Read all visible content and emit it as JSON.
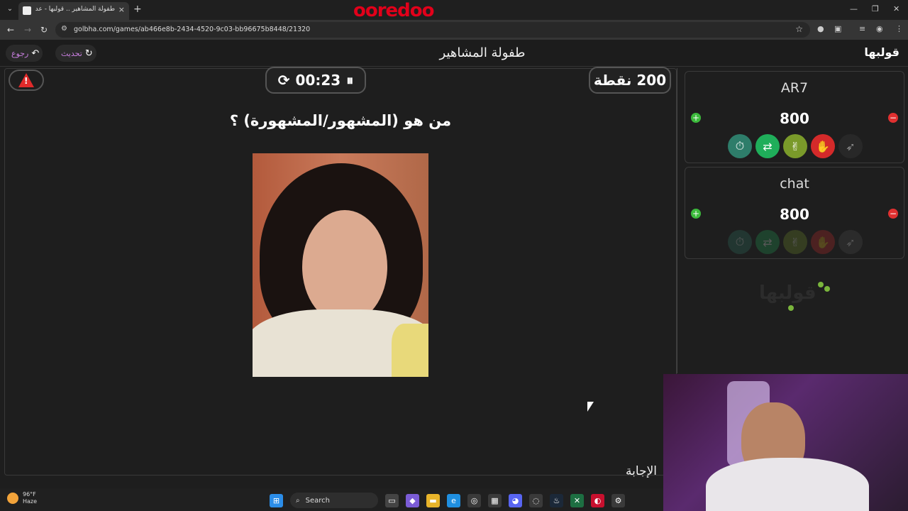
{
  "browser": {
    "tab_title": "طفولة المشاهير .. قولبها - عدل",
    "tab_close": "×",
    "new_tab": "+",
    "brand": "ooredoo",
    "url": "golbha.com/games/ab466e8b-2434-4520-9c03-bb96675b8448/21320",
    "controls": {
      "minimize": "—",
      "restore": "❐",
      "close": "✕"
    }
  },
  "header": {
    "back_label": "رجوع",
    "refresh_label": "تحديث",
    "title": "طفولة المشاهير",
    "logo": "قولبها"
  },
  "game": {
    "timer": "00:23",
    "points": "200 نقطة",
    "question": "من هو (المشهور/المشهورة) ؟",
    "answer_label": "الإجابة"
  },
  "players": [
    {
      "name": "AR7",
      "score": "800",
      "plus": "+",
      "minus": "−",
      "powerups_active": true
    },
    {
      "name": "chat",
      "score": "800",
      "plus": "+",
      "minus": "−",
      "powerups_active": false
    }
  ],
  "powerups": [
    {
      "icon": "stopwatch-icon",
      "glyph": "⏱",
      "color": "#2e7d6a"
    },
    {
      "icon": "swap-icon",
      "glyph": "⇄",
      "color": "#1fae5a"
    },
    {
      "icon": "peace-hand-icon",
      "glyph": "✌",
      "color": "#7a9a2a"
    },
    {
      "icon": "stop-hand-icon",
      "glyph": "✋",
      "color": "#d42a2a"
    },
    {
      "icon": "runner-icon",
      "glyph": "➶",
      "color": "#555555"
    }
  ],
  "sidebar": {
    "watermark": "قولبها"
  },
  "taskbar": {
    "temperature": "96°F",
    "condition": "Haze",
    "search_label": "Search"
  }
}
